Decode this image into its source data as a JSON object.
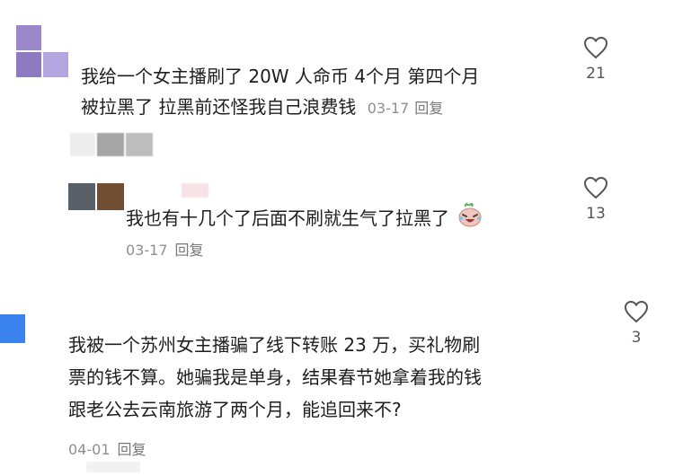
{
  "comments": [
    {
      "text_lines": [
        "我给一个女主播刷了 20W 人命币  4个月   第四个月",
        "被拉黑了 拉黑前还怪我自己浪费钱"
      ],
      "date": "03-17",
      "reply_label": "回复",
      "likes": "21"
    },
    {
      "text": "我也有十几个了后面不刷就生气了拉黑了",
      "emoji": "crying-laughing-emoji",
      "date": "03-17",
      "reply_label": "回复",
      "likes": "13"
    },
    {
      "text_lines": [
        "我被一个苏州女主播骗了线下转账 23 万，买礼物刷",
        "票的钱不算。她骗我是单身，结果春节她拿着我的钱",
        "跟老公去云南旅游了两个月，能追回来不?"
      ],
      "date": "04-01",
      "reply_label": "回复",
      "likes": "3"
    }
  ],
  "colors": {
    "avatar1": "#9b87c9",
    "avatar3": "#3a82ee",
    "text": "#1e1e1e",
    "meta": "#8f8f8f"
  }
}
